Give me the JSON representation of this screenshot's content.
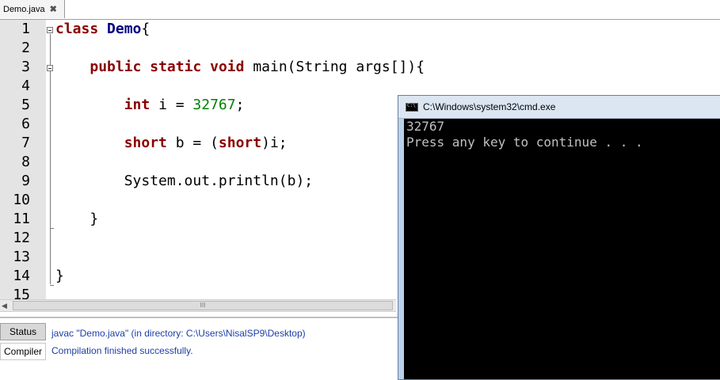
{
  "editor_tab": {
    "filename": "Demo.java",
    "close_glyph": "✖"
  },
  "line_numbers": [
    "1",
    "2",
    "3",
    "4",
    "5",
    "6",
    "7",
    "8",
    "9",
    "10",
    "11",
    "12",
    "13",
    "14",
    "15"
  ],
  "code": {
    "l1_kw": "class",
    "l1_cls": "Demo",
    "l1_rest": "{",
    "l3_kw1": "public",
    "l3_kw2": "static",
    "l3_kw3": "void",
    "l3_rest": "main(String args[]){",
    "l5_kw": "int",
    "l5_mid": "i = ",
    "l5_num": "32767",
    "l5_end": ";",
    "l7_kw": "short",
    "l7_mid": "b = (",
    "l7_kw2": "short",
    "l7_end": ")i;",
    "l9": "System.out.println(b);",
    "l11": "}",
    "l14": "}"
  },
  "scrollbar": {
    "left_arrow": "◀",
    "grip": "III"
  },
  "panel": {
    "status_tab": "Status",
    "compiler_tab": "Compiler",
    "message1": "javac \"Demo.java\" (in directory: C:\\Users\\NisalSP9\\Desktop)",
    "message2": "Compilation finished successfully."
  },
  "cmd_window": {
    "title": "C:\\Windows\\system32\\cmd.exe",
    "output_line1": "32767",
    "output_line2": "Press any key to continue . . ."
  },
  "colors": {
    "keyword": "#8b0000",
    "class_name": "#000080",
    "number": "#008000",
    "message": "#1a3fa8",
    "console_bg": "#000000",
    "console_text": "#c0c0c0"
  }
}
